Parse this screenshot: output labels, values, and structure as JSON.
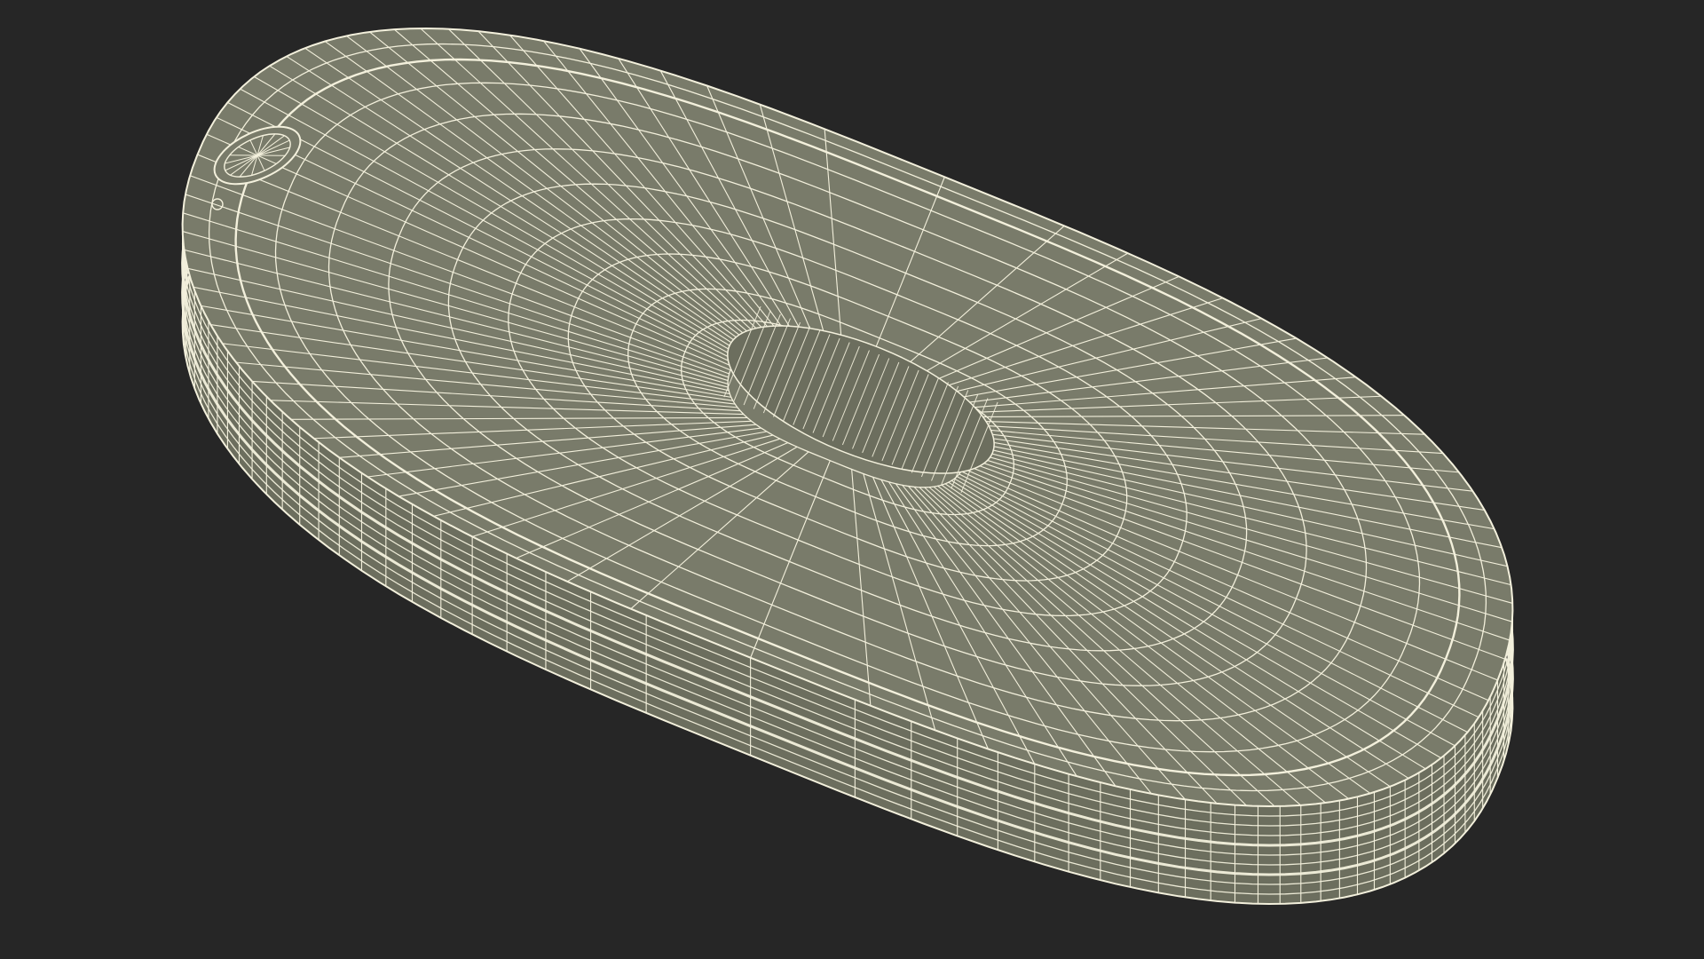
{
  "scene": {
    "subject": "wireframe-capsule-model",
    "colors": {
      "background": "#262626",
      "surface": "#797b6a",
      "surface_shadow": "#6c6e5e",
      "wire": "#f3f0dc"
    }
  }
}
